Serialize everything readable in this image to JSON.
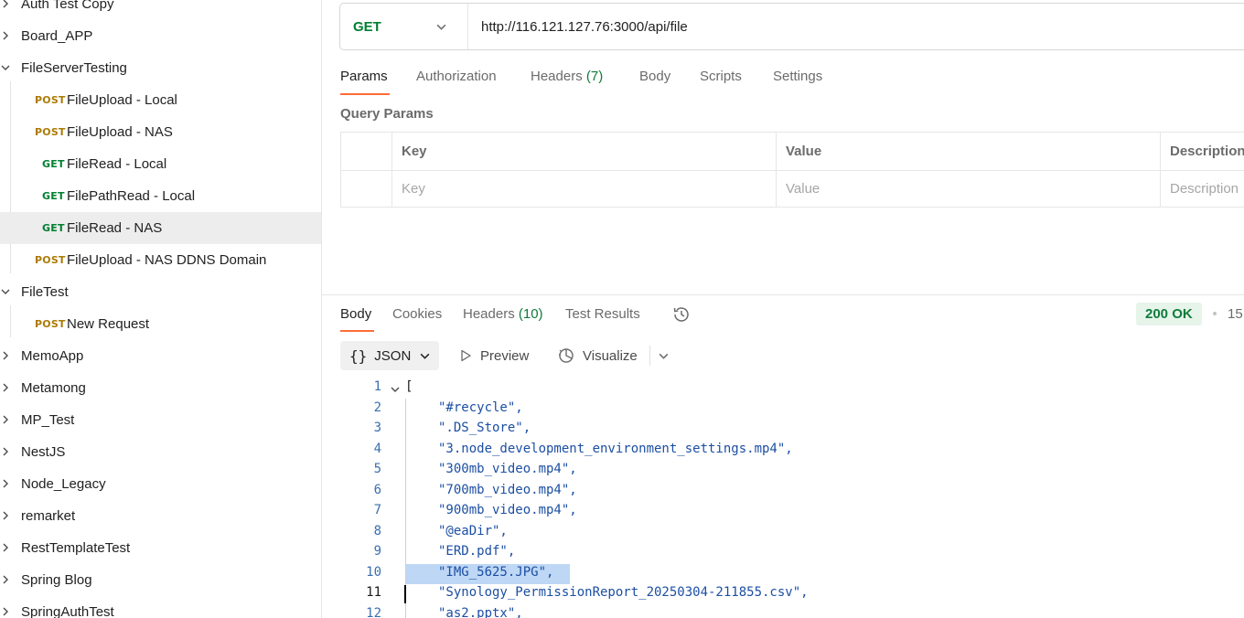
{
  "sidebar": {
    "items": [
      {
        "kind": "folder",
        "label": "Auth Test Copy",
        "expanded": false
      },
      {
        "kind": "folder",
        "label": "Board_APP",
        "expanded": false
      },
      {
        "kind": "folder",
        "label": "FileServerTesting",
        "expanded": true
      },
      {
        "kind": "request",
        "method": "POST",
        "label": "FileUpload - Local"
      },
      {
        "kind": "request",
        "method": "POST",
        "label": "FileUpload - NAS"
      },
      {
        "kind": "request",
        "method": "GET",
        "label": "FileRead - Local"
      },
      {
        "kind": "request",
        "method": "GET",
        "label": "FilePathRead - Local"
      },
      {
        "kind": "request",
        "method": "GET",
        "label": "FileRead - NAS",
        "selected": true
      },
      {
        "kind": "request",
        "method": "POST",
        "label": "FileUpload - NAS DDNS Domain"
      },
      {
        "kind": "folder",
        "label": "FileTest",
        "expanded": true
      },
      {
        "kind": "request",
        "method": "POST",
        "label": "New Request"
      },
      {
        "kind": "folder",
        "label": "MemoApp",
        "expanded": false
      },
      {
        "kind": "folder",
        "label": "Metamong",
        "expanded": false
      },
      {
        "kind": "folder",
        "label": "MP_Test",
        "expanded": false
      },
      {
        "kind": "folder",
        "label": "NestJS",
        "expanded": false
      },
      {
        "kind": "folder",
        "label": "Node_Legacy",
        "expanded": false
      },
      {
        "kind": "folder",
        "label": "remarket",
        "expanded": false
      },
      {
        "kind": "folder",
        "label": "RestTemplateTest",
        "expanded": false
      },
      {
        "kind": "folder",
        "label": "Spring Blog",
        "expanded": false
      },
      {
        "kind": "folder",
        "label": "SpringAuthTest",
        "expanded": false
      }
    ]
  },
  "request": {
    "method": "GET",
    "url": "http://116.121.127.76:3000/api/file",
    "tabs": {
      "params": "Params",
      "authorization": "Authorization",
      "headers": "Headers",
      "headers_count": "(7)",
      "body": "Body",
      "scripts": "Scripts",
      "settings": "Settings"
    },
    "query_params": {
      "title": "Query Params",
      "col_key": "Key",
      "col_value": "Value",
      "col_description": "Description",
      "ph_key": "Key",
      "ph_value": "Value",
      "ph_description": "Description"
    }
  },
  "response": {
    "tabs": {
      "body": "Body",
      "cookies": "Cookies",
      "headers": "Headers",
      "headers_count": "(10)",
      "test_results": "Test Results"
    },
    "status": "200 OK",
    "status_trunc": "15",
    "format": "JSON",
    "preview": "Preview",
    "visualize": "Visualize",
    "lines": [
      {
        "n": "1",
        "text": "["
      },
      {
        "n": "2",
        "text": "\"#recycle\","
      },
      {
        "n": "3",
        "text": "\".DS_Store\","
      },
      {
        "n": "4",
        "text": "\"3.node_development_environment_settings.mp4\","
      },
      {
        "n": "5",
        "text": "\"300mb_video.mp4\","
      },
      {
        "n": "6",
        "text": "\"700mb_video.mp4\","
      },
      {
        "n": "7",
        "text": "\"900mb_video.mp4\","
      },
      {
        "n": "8",
        "text": "\"@eaDir\","
      },
      {
        "n": "9",
        "text": "\"ERD.pdf\","
      },
      {
        "n": "10",
        "text": "\"IMG_5625.JPG\","
      },
      {
        "n": "11",
        "text": "\"Synology_PermissionReport_20250304-211855.csv\","
      },
      {
        "n": "12",
        "text": "\"as2.pptx\","
      }
    ]
  },
  "colors": {
    "accent": "#ff6c37",
    "get": "#007f31",
    "post": "#ad7a03",
    "status_ok": "#0f7b3b"
  }
}
